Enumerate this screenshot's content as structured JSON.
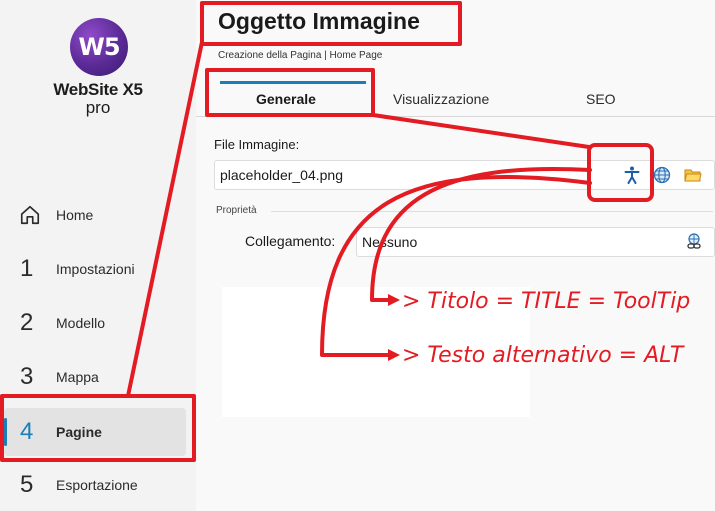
{
  "app": {
    "logo_mark": "W5",
    "logo_name": "WebSite X5",
    "logo_edition": "pro"
  },
  "sidebar": {
    "items": [
      {
        "number": "",
        "label": "Home",
        "icon": "home-icon",
        "active": false
      },
      {
        "number": "1",
        "label": "Impostazioni",
        "active": false
      },
      {
        "number": "2",
        "label": "Modello",
        "active": false
      },
      {
        "number": "3",
        "label": "Mappa",
        "active": false
      },
      {
        "number": "4",
        "label": "Pagine",
        "active": true
      },
      {
        "number": "5",
        "label": "Esportazione",
        "active": false
      }
    ]
  },
  "header": {
    "title": "Oggetto Immagine",
    "breadcrumb": "Creazione della Pagina | Home Page"
  },
  "tabs": [
    {
      "label": "Generale",
      "active": true
    },
    {
      "label": "Visualizzazione",
      "active": false
    },
    {
      "label": "SEO",
      "active": false
    }
  ],
  "form": {
    "file_label": "File Immagine:",
    "file_value": "placeholder_04.png",
    "file_icons": [
      "accessibility-icon",
      "globe-icon",
      "folder-icon"
    ],
    "section_title": "Proprietà",
    "link_label": "Collegamento:",
    "link_value": "Nessuno",
    "link_icon": "link-icon"
  },
  "annotations": {
    "note1": "> Titolo = TITLE = ToolTip",
    "note2": "> Testo alternativo = ALT"
  },
  "colors": {
    "accent": "#1a7fb8",
    "annotation": "#e31b23",
    "logo_purple": "#5a2a95"
  }
}
